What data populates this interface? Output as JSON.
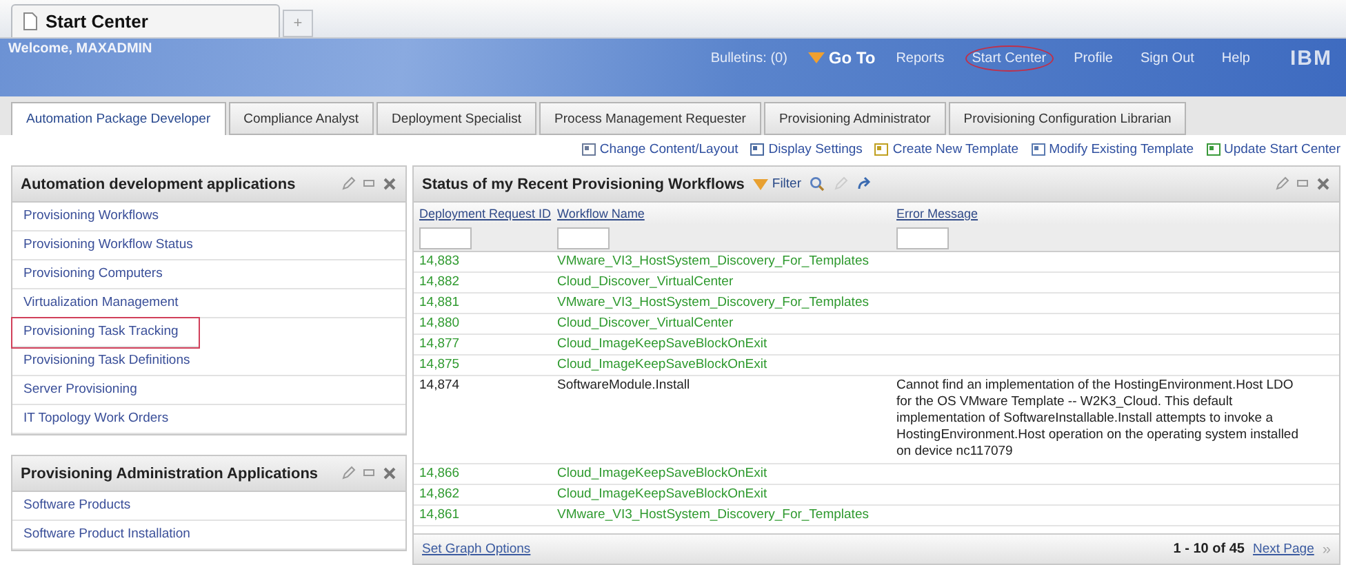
{
  "browser_tab": {
    "title": "Start Center",
    "new_tab": "+"
  },
  "header": {
    "welcome": "Welcome, MAXADMIN",
    "bulletins": "Bulletins: (0)",
    "goto": "Go To",
    "nav": [
      {
        "label": "Reports",
        "annotated": false
      },
      {
        "label": "Start Center",
        "annotated": true
      },
      {
        "label": "Profile",
        "annotated": false
      },
      {
        "label": "Sign Out",
        "annotated": false
      },
      {
        "label": "Help",
        "annotated": false
      }
    ],
    "logo": "IBM"
  },
  "tabs": [
    {
      "label": "Automation Package Developer",
      "selected": true
    },
    {
      "label": "Compliance Analyst",
      "selected": false
    },
    {
      "label": "Deployment Specialist",
      "selected": false
    },
    {
      "label": "Process Management Requester",
      "selected": false
    },
    {
      "label": "Provisioning Administrator",
      "selected": false
    },
    {
      "label": "Provisioning Configuration Librarian",
      "selected": false
    }
  ],
  "actions": [
    "Change Content/Layout",
    "Display Settings",
    "Create New Template",
    "Modify Existing Template",
    "Update Start Center"
  ],
  "portlets": [
    {
      "title": "Automation development applications",
      "items": [
        {
          "label": "Provisioning Workflows",
          "annotated": false
        },
        {
          "label": "Provisioning Workflow Status",
          "annotated": false
        },
        {
          "label": "Provisioning Computers",
          "annotated": false
        },
        {
          "label": "Virtualization Management",
          "annotated": false
        },
        {
          "label": "Provisioning Task Tracking",
          "annotated": true
        },
        {
          "label": "Provisioning Task Definitions",
          "annotated": false
        },
        {
          "label": "Server Provisioning",
          "annotated": false
        },
        {
          "label": "IT Topology Work Orders",
          "annotated": false
        }
      ]
    },
    {
      "title": "Provisioning Administration Applications",
      "items": [
        {
          "label": "Software Products",
          "annotated": false
        },
        {
          "label": "Software Product Installation",
          "annotated": false
        }
      ]
    }
  ],
  "workflows": {
    "title": "Status of my Recent Provisioning Workflows",
    "filter": "Filter",
    "columns": [
      "Deployment Request ID",
      "Workflow Name",
      "Error Message"
    ],
    "rows": [
      {
        "id": "14,883",
        "workflow": "VMware_VI3_HostSystem_Discovery_For_Templates",
        "color": "#2f9a2f"
      },
      {
        "id": "14,882",
        "workflow": "Cloud_Discover_VirtualCenter",
        "color": "#2f9a2f"
      },
      {
        "id": "14,881",
        "workflow": "VMware_VI3_HostSystem_Discovery_For_Templates",
        "color": "#2f9a2f"
      },
      {
        "id": "14,880",
        "workflow": "Cloud_Discover_VirtualCenter",
        "color": "#2f9a2f"
      },
      {
        "id": "14,877",
        "workflow": "Cloud_ImageKeepSaveBlockOnExit",
        "color": "#2f9a2f"
      },
      {
        "id": "14,875",
        "workflow": "Cloud_ImageKeepSaveBlockOnExit",
        "color": "#2f9a2f"
      },
      {
        "id": "14,874",
        "workflow": "SoftwareModule.Install",
        "color": "#222222",
        "error": "Cannot find an implementation of the HostingEnvironment.Host LDO for the OS VMware Template -- W2K3_Cloud. This default implementation of SoftwareInstallable.Install attempts to invoke a HostingEnvironment.Host operation on the operating system installed on device nc117079"
      },
      {
        "id": "14,866",
        "workflow": "Cloud_ImageKeepSaveBlockOnExit",
        "color": "#2f9a2f"
      },
      {
        "id": "14,862",
        "workflow": "Cloud_ImageKeepSaveBlockOnExit",
        "color": "#2f9a2f"
      },
      {
        "id": "14,861",
        "workflow": "VMware_VI3_HostSystem_Discovery_For_Templates",
        "color": "#2f9a2f"
      }
    ],
    "graph_options": "Set Graph Options",
    "range": "1 - 10 of 45",
    "next": "Next Page",
    "next_arrows": "»"
  }
}
